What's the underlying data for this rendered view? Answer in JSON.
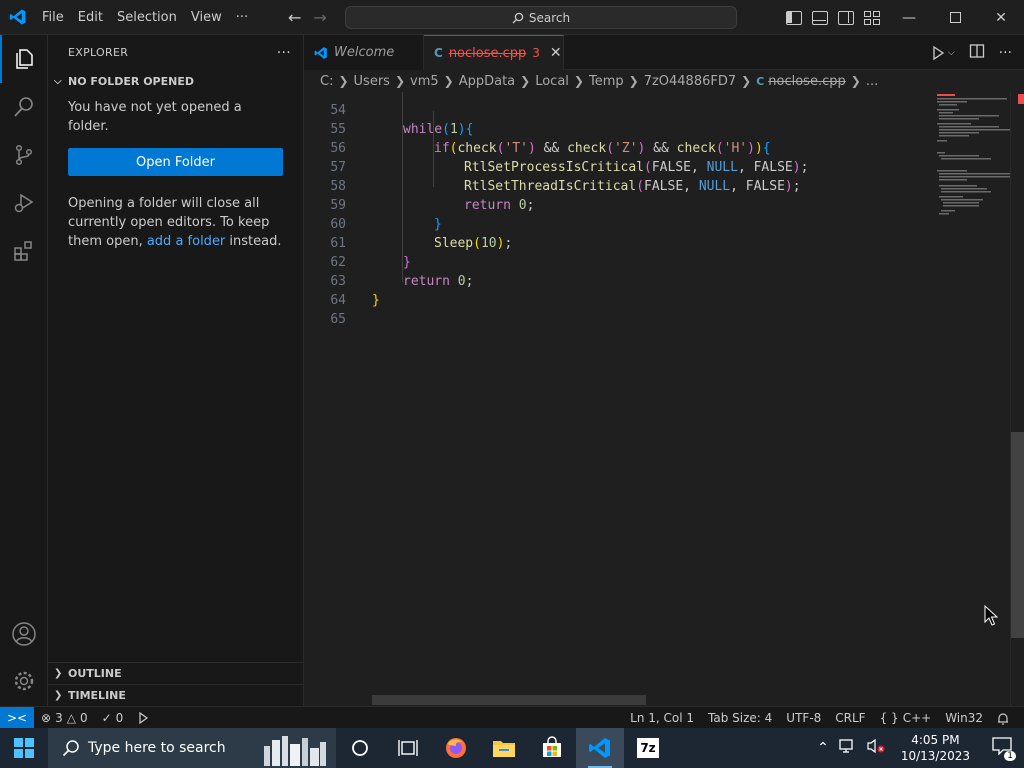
{
  "titlebar": {
    "menu": [
      "File",
      "Edit",
      "Selection",
      "View",
      "···"
    ],
    "search_label": "Search"
  },
  "sidebar": {
    "title": "EXPLORER",
    "more": "···",
    "section_title": "NO FOLDER OPENED",
    "message": "You have not yet opened a folder.",
    "open_folder_label": "Open Folder",
    "info_before": "Opening a folder will close all currently open editors. To keep them open, ",
    "info_link": "add a folder",
    "info_after": " instead.",
    "outline_label": "OUTLINE",
    "timeline_label": "TIMELINE"
  },
  "tabs": [
    {
      "label": "Welcome",
      "icon": "vscode-icon"
    },
    {
      "label": "noclose.cpp",
      "badge": "3",
      "icon": "cpp-file-icon"
    }
  ],
  "breadcrumb": [
    "C:",
    "Users",
    "vm5",
    "AppData",
    "Local",
    "Temp",
    "7zO44886FD7",
    "noclose.cpp",
    "..."
  ],
  "editor": {
    "line_numbers": [
      "54",
      "55",
      "56",
      "57",
      "58",
      "59",
      "60",
      "61",
      "62",
      "63",
      "64",
      "65"
    ]
  },
  "statusbar": {
    "problems_errors": "3",
    "problems_warnings": "0",
    "ports": "0",
    "position": "Ln 1, Col 1",
    "tab_size": "Tab Size: 4",
    "encoding": "UTF-8",
    "eol": "CRLF",
    "language": "C++",
    "config": "Win32"
  },
  "taskbar": {
    "search_placeholder": "Type here to search",
    "time": "4:05 PM",
    "date": "10/13/2023",
    "notification_count": "1",
    "apps": [
      "cortana-icon",
      "task-view-icon",
      "firefox-icon",
      "file-explorer-icon",
      "store-icon",
      "vscode-icon",
      "7zip-icon"
    ]
  },
  "colors": {
    "accent": "#0078d4",
    "error": "#f85149",
    "keyword": "#c586c0",
    "function": "#dcdcaa",
    "string": "#ce9178",
    "number": "#b5cea8",
    "macro": "#569cd6"
  }
}
